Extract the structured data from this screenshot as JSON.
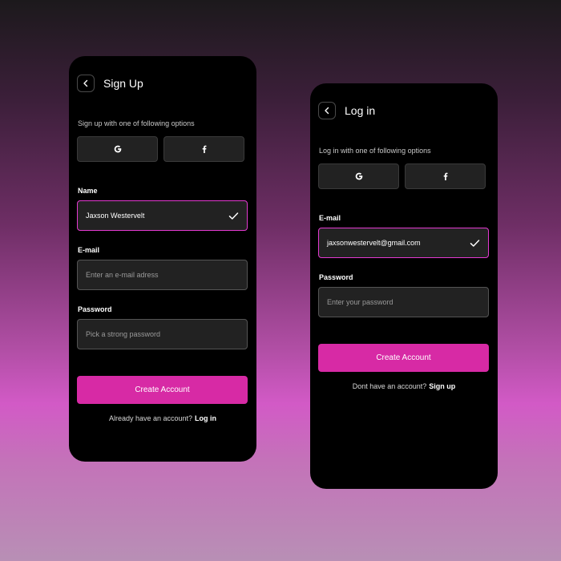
{
  "signup": {
    "title": "Sign Up",
    "subtitle": "Sign up with one of following options",
    "name_label": "Name",
    "name_value": "Jaxson Westervelt",
    "email_label": "E-mail",
    "email_placeholder": "Enter an e-mail adress",
    "password_label": "Password",
    "password_placeholder": "Pick a strong password",
    "cta_label": "Create Account",
    "footer_text": "Already have an account?",
    "footer_link": "Log in"
  },
  "login": {
    "title": "Log in",
    "subtitle": "Log in with one of following options",
    "email_label": "E-mail",
    "email_value": "jaxsonwestervelt@gmail.com",
    "password_label": "Password",
    "password_placeholder": "Enter your password",
    "cta_label": "Create Account",
    "footer_text": "Dont have an account?",
    "footer_link": "Sign up"
  },
  "icons": {
    "back": "chevron-left-icon",
    "google": "google-icon",
    "facebook": "facebook-icon",
    "check": "check-icon"
  },
  "colors": {
    "accent": "#d72aa5",
    "active_border": "#e43ad1",
    "card": "#000000",
    "field_bg": "#222222"
  }
}
